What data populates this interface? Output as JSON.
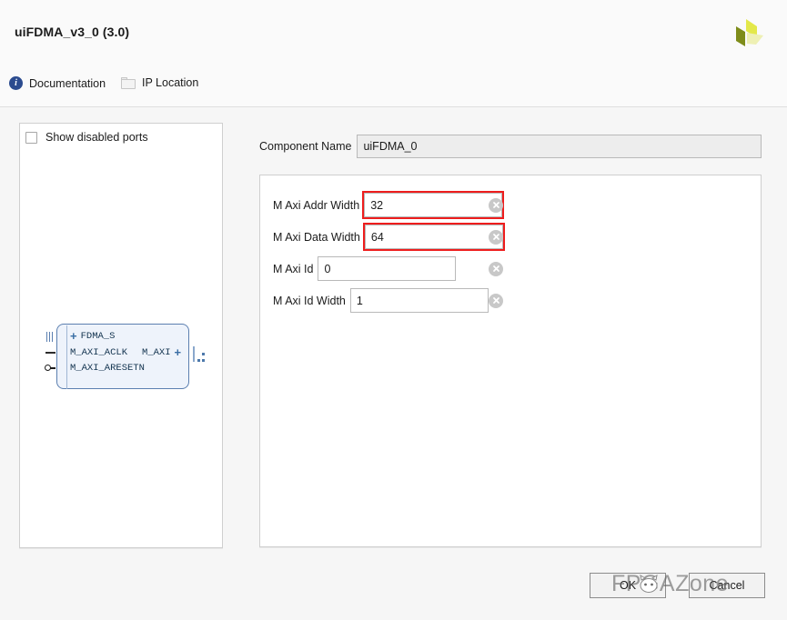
{
  "header": {
    "title": "uiFDMA_v3_0 (3.0)",
    "logo_name": "xilinx-amd-logo",
    "logo_colors": [
      "#e3e84a",
      "#7e8c1a",
      "#eef0b4"
    ]
  },
  "toolbar": {
    "documentation_label": "Documentation",
    "documentation_icon": "info-icon",
    "ip_location_label": "IP Location",
    "ip_location_icon": "folder-icon"
  },
  "left_panel": {
    "show_disabled_ports_label": "Show disabled ports",
    "show_disabled_ports_checked": false,
    "ip_block": {
      "border_color": "#5b7fb0",
      "fill_color": "#eef3fb",
      "ports": [
        {
          "name": "FDMA_S",
          "expander": "+",
          "connector": "bus",
          "side": "left"
        },
        {
          "name": "M_AXI_ACLK",
          "connector": "clock",
          "side": "left"
        },
        {
          "name": "M_AXI_ARESETN",
          "connector": "reset",
          "side": "left"
        }
      ],
      "output_port": {
        "name": "M_AXI",
        "expander": "+",
        "connector": "bus",
        "side": "right"
      }
    }
  },
  "right_panel": {
    "component_name_label": "Component Name",
    "component_name_value": "uiFDMA_0",
    "parameters": [
      {
        "label": "M Axi Addr Width",
        "value": "32",
        "highlighted": true,
        "clear_icon": "clear-icon"
      },
      {
        "label": "M Axi Data Width",
        "value": "64",
        "highlighted": true,
        "clear_icon": "clear-icon"
      },
      {
        "label": "M Axi Id",
        "value": "0",
        "highlighted": false,
        "clear_icon": "clear-icon"
      },
      {
        "label": "M Axi Id Width",
        "value": "1",
        "highlighted": false,
        "clear_icon": "clear-icon"
      }
    ],
    "highlight_color": "#ee1d1d"
  },
  "footer": {
    "ok_label": "OK",
    "cancel_label": "Cancel"
  },
  "watermark": {
    "text": "FPGAZone"
  }
}
